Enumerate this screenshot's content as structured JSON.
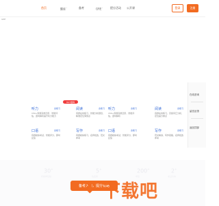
{
  "nav": {
    "items": [
      {
        "label": "首页",
        "sup": ""
      },
      {
        "label": "题库",
        "sup": "⌄"
      },
      {
        "label": "备考",
        "sup": ""
      },
      {
        "label": "GRE",
        "sup": "⌄"
      },
      {
        "label": "提分活动",
        "sup": ""
      },
      {
        "label": "公开课",
        "sup": ""
      }
    ],
    "login_label": "登录",
    "register_label": "注册"
  },
  "tiny_label": "GRE",
  "hot_badge": "HOT题库",
  "cards": [
    {
      "title": "听力",
      "link": "去练习",
      "desc": "150+真题完整还原，智能评估，逐句精听提升听力能力"
    },
    {
      "title": "阅读",
      "link": "去练习",
      "desc": "真题在线练习，智能分析题目，精准定位薄弱点"
    },
    {
      "title": "听力",
      "link": "去练习",
      "desc": "150+真题完整还原，智能评估，逐句精听"
    },
    {
      "title": "阅读",
      "link": "去练习",
      "desc": "真题在线练习，高频词汇分析，定位提分重点"
    },
    {
      "title": "口语",
      "link": "去练习",
      "desc": "真题模拟考试，智能评分，即时反馈"
    },
    {
      "title": "写作",
      "link": "去练习",
      "desc": "真题模拟练习，名师批改，范文参考"
    },
    {
      "title": "口语",
      "link": "去练习",
      "desc": "真题模拟考试，智能评分，即时反馈"
    },
    {
      "title": "写作",
      "link": "去练习",
      "desc": "范文精讲，写作思路，名师批改参考"
    }
  ],
  "side_panel": [
    "在线咨询",
    "留言反馈",
    "返回顶部"
  ],
  "stats": [
    {
      "value": "30",
      "sup": "+",
      "caption": "年教学经验"
    },
    {
      "value": "5",
      "sup": "+",
      "caption": "位名师"
    },
    {
      "value": "200",
      "sup": "+",
      "caption": "学员"
    },
    {
      "value": "2",
      "sup": "+",
      "caption": "考试方向"
    }
  ],
  "cta_label": "备考入口，提分有路",
  "watermark_text": "下载吧",
  "watermark_icon": "download-icon"
}
